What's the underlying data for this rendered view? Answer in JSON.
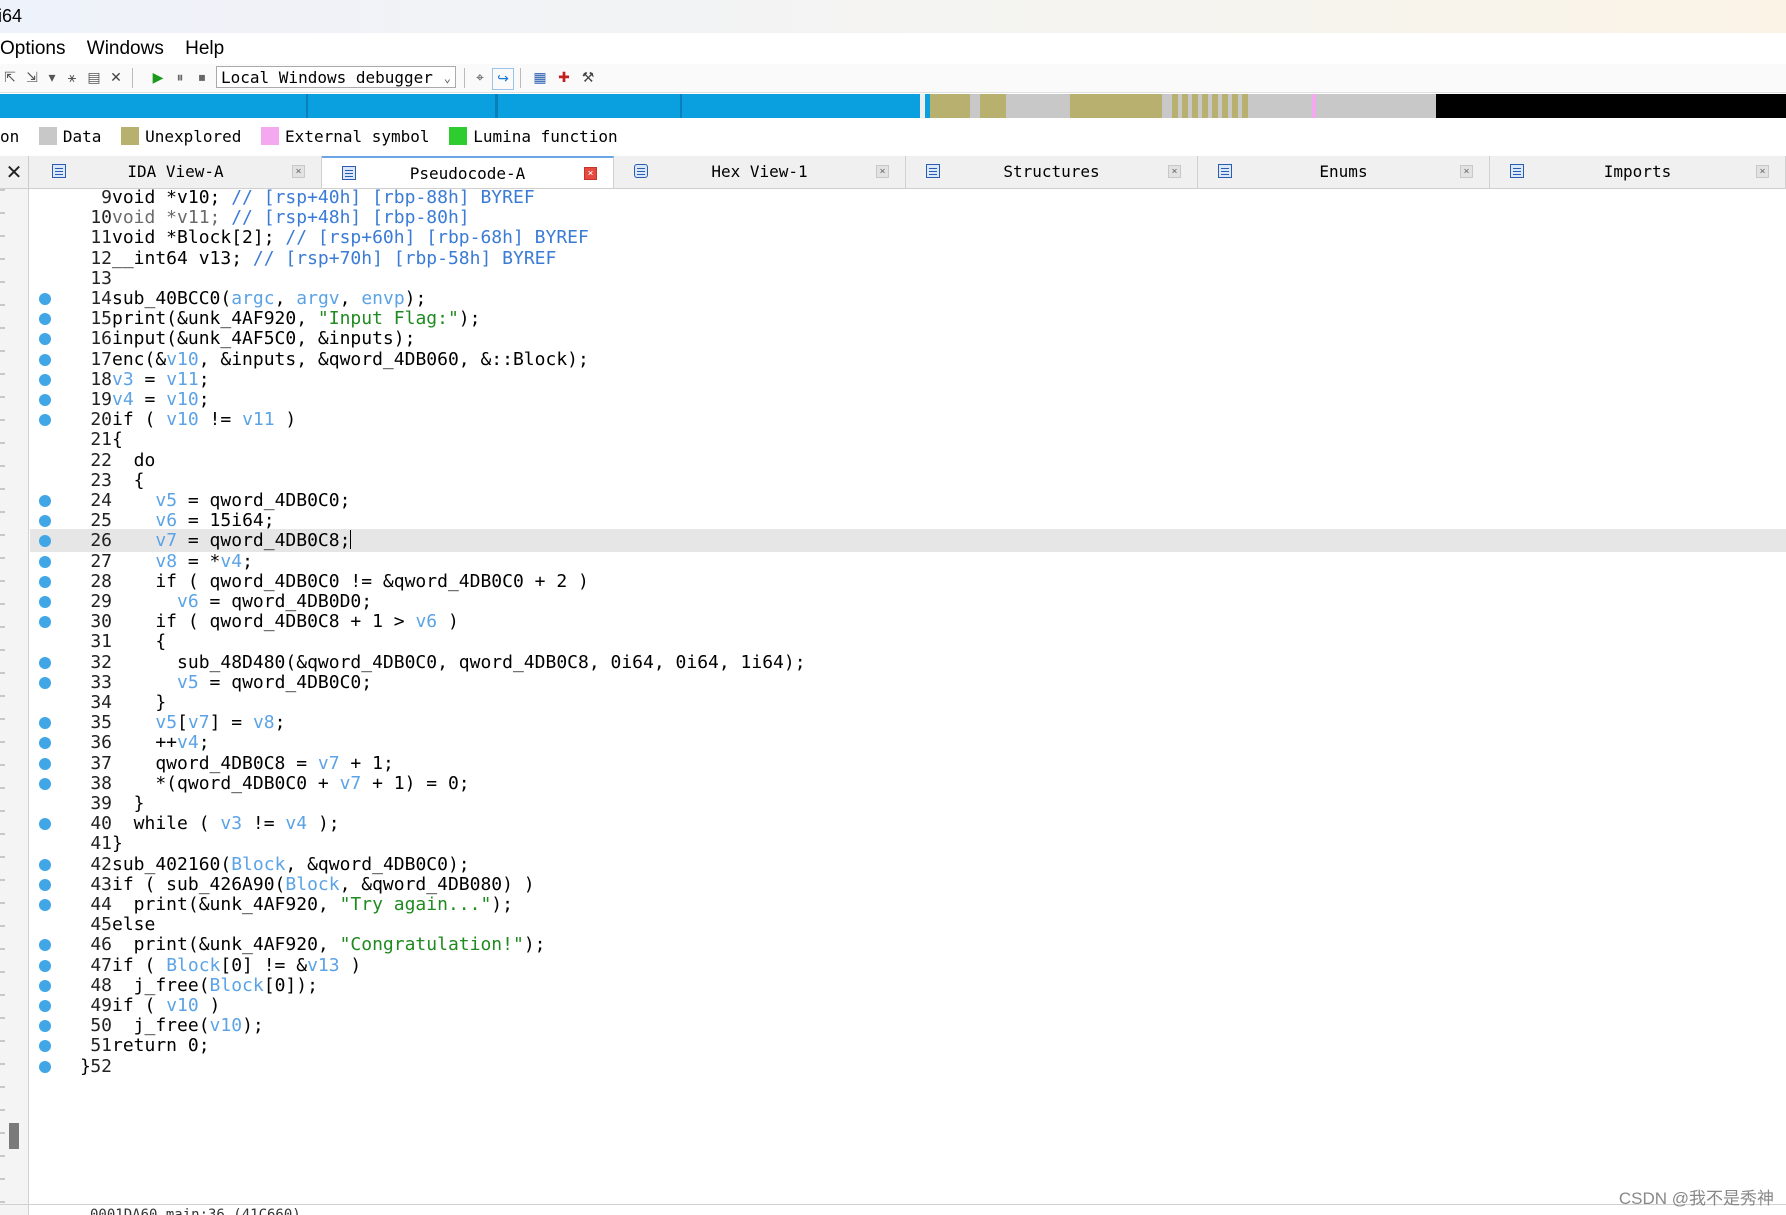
{
  "window": {
    "title": "i64"
  },
  "menu": {
    "items": [
      "Options",
      "Windows",
      "Help"
    ]
  },
  "toolbar": {
    "debugger_select": "Local Windows debugger",
    "icons": [
      "plugin-icon",
      "plugin-icon-2",
      "dropdown-icon",
      "plugin-icon-3",
      "open-icon",
      "close-icon",
      "play-icon",
      "pause-icon",
      "stop-icon",
      "breakpoint-icon",
      "step-icon",
      "graph-icon",
      "structure-icon",
      "tool-icon"
    ]
  },
  "legend": {
    "items": [
      {
        "label": "on",
        "color": null
      },
      {
        "label": "Data",
        "color": "#c8c8c8"
      },
      {
        "label": "Unexplored",
        "color": "#b7b06e"
      },
      {
        "label": "External symbol",
        "color": "#f4a8f0"
      },
      {
        "label": "Lumina function",
        "color": "#2ecc2e"
      }
    ]
  },
  "tabs": [
    {
      "label": "IDA View-A",
      "active": false
    },
    {
      "label": "Pseudocode-A",
      "active": true
    },
    {
      "label": "Hex View-1",
      "active": false
    },
    {
      "label": "Structures",
      "active": false
    },
    {
      "label": "Enums",
      "active": false
    },
    {
      "label": "Imports",
      "active": false
    }
  ],
  "code_lines": [
    {
      "n": "9",
      "bp": false,
      "text": "void *v10; // [rsp+40h] [rbp-88h] BYREF"
    },
    {
      "n": "10",
      "bp": false,
      "text": "void *v11; // [rsp+48h] [rbp-80h]"
    },
    {
      "n": "11",
      "bp": false,
      "text": "void *Block[2]; // [rsp+60h] [rbp-68h] BYREF"
    },
    {
      "n": "12",
      "bp": false,
      "text": "__int64 v13; // [rsp+70h] [rbp-58h] BYREF"
    },
    {
      "n": "13",
      "bp": false,
      "text": ""
    },
    {
      "n": "14",
      "bp": true,
      "text": "sub_40BCC0(argc, argv, envp);"
    },
    {
      "n": "15",
      "bp": true,
      "text": "print(&unk_4AF920, \"Input Flag:\");"
    },
    {
      "n": "16",
      "bp": true,
      "text": "input(&unk_4AF5C0, &inputs);"
    },
    {
      "n": "17",
      "bp": true,
      "text": "enc(&v10, &inputs, &qword_4DB060, &::Block);"
    },
    {
      "n": "18",
      "bp": true,
      "text": "v3 = v11;"
    },
    {
      "n": "19",
      "bp": true,
      "text": "v4 = v10;"
    },
    {
      "n": "20",
      "bp": true,
      "text": "if ( v10 != v11 )"
    },
    {
      "n": "21",
      "bp": false,
      "text": "{"
    },
    {
      "n": "22",
      "bp": false,
      "text": "  do"
    },
    {
      "n": "23",
      "bp": false,
      "text": "  {"
    },
    {
      "n": "24",
      "bp": true,
      "text": "    v5 = qword_4DB0C0;"
    },
    {
      "n": "25",
      "bp": true,
      "text": "    v6 = 15i64;"
    },
    {
      "n": "26",
      "bp": true,
      "text": "    v7 = qword_4DB0C8;",
      "highlight": true
    },
    {
      "n": "27",
      "bp": true,
      "text": "    v8 = *v4;"
    },
    {
      "n": "28",
      "bp": true,
      "text": "    if ( qword_4DB0C0 != &qword_4DB0C0 + 2 )"
    },
    {
      "n": "29",
      "bp": true,
      "text": "      v6 = qword_4DB0D0;"
    },
    {
      "n": "30",
      "bp": true,
      "text": "    if ( qword_4DB0C8 + 1 > v6 )"
    },
    {
      "n": "31",
      "bp": false,
      "text": "    {"
    },
    {
      "n": "32",
      "bp": true,
      "text": "      sub_48D480(&qword_4DB0C0, qword_4DB0C8, 0i64, 0i64, 1i64);"
    },
    {
      "n": "33",
      "bp": true,
      "text": "      v5 = qword_4DB0C0;"
    },
    {
      "n": "34",
      "bp": false,
      "text": "    }"
    },
    {
      "n": "35",
      "bp": true,
      "text": "    v5[v7] = v8;"
    },
    {
      "n": "36",
      "bp": true,
      "text": "    ++v4;"
    },
    {
      "n": "37",
      "bp": true,
      "text": "    qword_4DB0C8 = v7 + 1;"
    },
    {
      "n": "38",
      "bp": true,
      "text": "    *(qword_4DB0C0 + v7 + 1) = 0;"
    },
    {
      "n": "39",
      "bp": false,
      "text": "  }"
    },
    {
      "n": "40",
      "bp": true,
      "text": "  while ( v3 != v4 );"
    },
    {
      "n": "41",
      "bp": false,
      "text": "}"
    },
    {
      "n": "42",
      "bp": true,
      "text": "sub_402160(Block, &qword_4DB0C0);"
    },
    {
      "n": "43",
      "bp": true,
      "text": "if ( sub_426A90(Block, &qword_4DB080) )"
    },
    {
      "n": "44",
      "bp": true,
      "text": "  print(&unk_4AF920, \"Try again...\");"
    },
    {
      "n": "45",
      "bp": false,
      "text": "else"
    },
    {
      "n": "46",
      "bp": true,
      "text": "  print(&unk_4AF920, \"Congratulation!\");"
    },
    {
      "n": "47",
      "bp": true,
      "text": "if ( Block[0] != &v13 )"
    },
    {
      "n": "48",
      "bp": true,
      "text": "  j_free(Block[0]);"
    },
    {
      "n": "49",
      "bp": true,
      "text": "if ( v10 )"
    },
    {
      "n": "50",
      "bp": true,
      "text": "  j_free(v10);"
    },
    {
      "n": "51",
      "bp": true,
      "text": "return 0;"
    },
    {
      "n": "52",
      "bp": true,
      "text": "}",
      "closing": true
    }
  ],
  "status": {
    "text": "0001DA60 main:36 (41C660)"
  },
  "watermark": {
    "text": "CSDN @我不是秀神"
  },
  "colors": {
    "variable": "#5ba3e6",
    "comment": "#3a7bd5",
    "string": "#1f8a1f",
    "breakpoint": "#41a6e6",
    "highlight_line": "#e6e6e6",
    "navband_code": "#0aa0e0",
    "navband_unexplored": "#b7b06e",
    "navband_data": "#c8c8c8",
    "navband_end": "#000000"
  }
}
